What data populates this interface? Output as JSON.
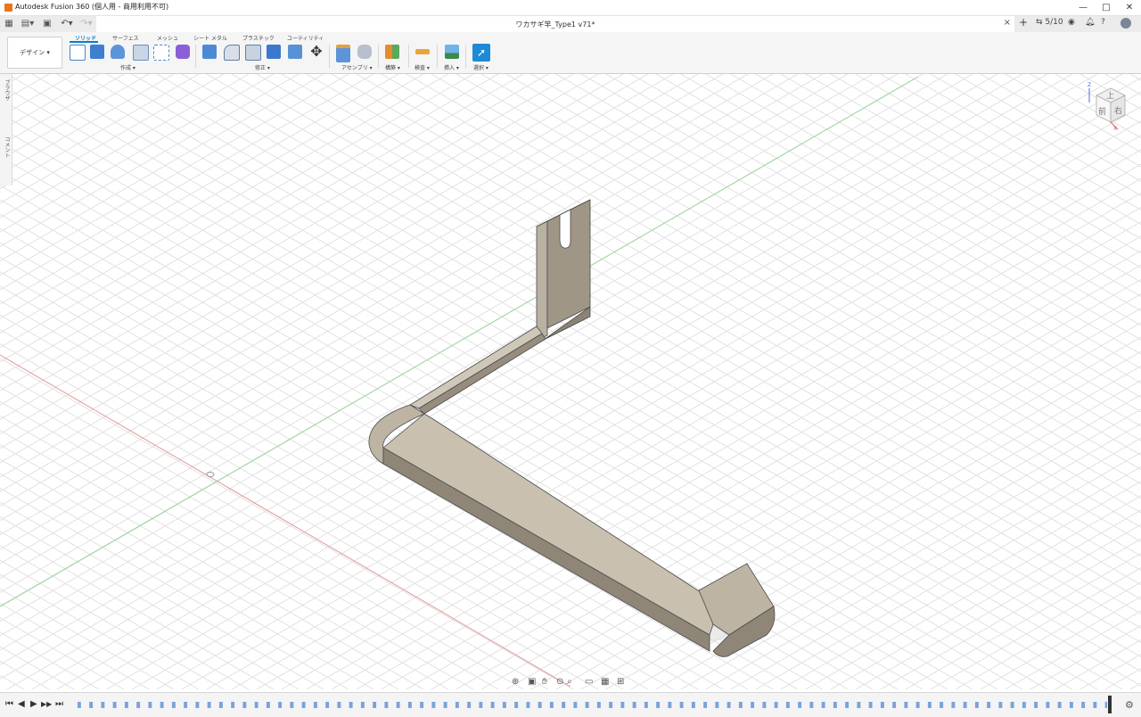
{
  "window": {
    "title": "Autodesk Fusion 360 (個人用 - 商用利用不可)",
    "minimize": "—",
    "maximize": "□",
    "close": "✕"
  },
  "tabbar": {
    "doc_title": "ワカサギ竿_Type1 v71*",
    "close": "×",
    "add": "+",
    "jobs": "5/10"
  },
  "ribbon": {
    "workspace": "デザイン ▾",
    "tabs": [
      "ソリッド",
      "サーフェス",
      "メッシュ",
      "シート メタル",
      "プラスチック",
      "ユーティリティ"
    ],
    "groups": {
      "create": "作成 ▾",
      "modify": "修正 ▾",
      "assemble": "アセンブリ ▾",
      "construct": "構築 ▾",
      "inspect": "検査 ▾",
      "insert": "挿入 ▾",
      "select": "選択 ▾"
    }
  },
  "side_panel": {
    "browser": "ブラウザ",
    "comments": "コメント"
  },
  "viewcube": {
    "top": "上",
    "front": "前",
    "right": "右",
    "axis_z": "Z",
    "axis_x": "X"
  },
  "colors": {
    "accent": "#0a7fc9",
    "model_top": "#cfc7b8",
    "model_side": "#9a9080",
    "model_edge": "#4a4a4a",
    "grid_line": "#e2e2e2",
    "x_axis": "#e59595",
    "y_axis": "#9bd49b"
  },
  "icons": {
    "nav": [
      "orbit-icon",
      "look-at-icon",
      "pan-icon",
      "zoom-icon",
      "fit-icon",
      "display-settings-icon",
      "grid-settings-icon",
      "viewports-icon"
    ]
  },
  "timeline": {
    "controls": [
      "⏮",
      "◀",
      "▶",
      "▶▶",
      "⏭"
    ],
    "settings": "⚙"
  }
}
